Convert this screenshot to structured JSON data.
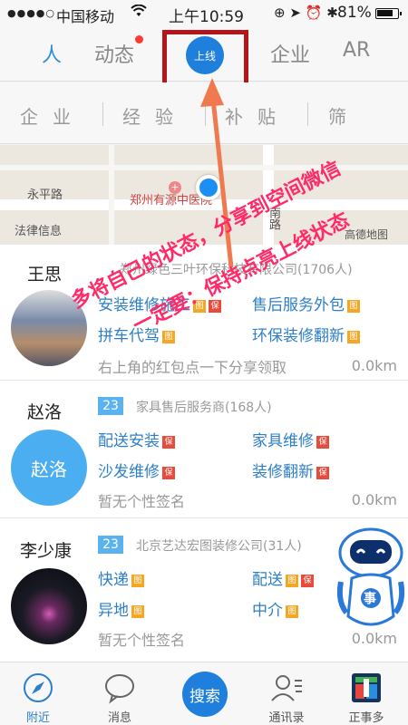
{
  "status_bar": {
    "signal_dots": "●●●●○",
    "carrier": "中国移动",
    "time": "上午10:59",
    "battery_percent": "81%",
    "battery_level": 0.81
  },
  "top_tabs": [
    {
      "label": "人",
      "active": true
    },
    {
      "label": "动态",
      "has_badge": true
    },
    {
      "label": "上线"
    },
    {
      "label": "企业"
    },
    {
      "label": "AR"
    }
  ],
  "filters": [
    "企业",
    "经验",
    "补贴",
    "筛"
  ],
  "map": {
    "labels": [
      "永平路",
      "郑州有源中医院",
      "法律信息",
      "南路"
    ],
    "provider": "高德地图"
  },
  "contacts": [
    {
      "name": "王思",
      "company": "郑州绿色三叶环保科技有限公司(1706人)",
      "services": [
        {
          "label": "安装维修施工",
          "tags": [
            "图",
            "保"
          ]
        },
        {
          "label": "售后服务外包",
          "tags": [
            "图"
          ]
        },
        {
          "label": "拼车代驾",
          "tags": [
            "图"
          ]
        },
        {
          "label": "环保装修翻新",
          "tags": [
            "图"
          ]
        }
      ],
      "signature": "右上角的红包点一下分享领取",
      "distance": "0.0km"
    },
    {
      "name": "赵洛",
      "avatar_text": "赵洛",
      "count": "23",
      "company": "家具售后服务商(168人)",
      "services": [
        {
          "label": "配送安装",
          "tags": [
            "保"
          ]
        },
        {
          "label": "家具维修",
          "tags": [
            "保"
          ]
        },
        {
          "label": "沙发维修",
          "tags": [
            "保"
          ]
        },
        {
          "label": "装修翻新",
          "tags": [
            "保"
          ]
        }
      ],
      "signature": "暂无个性签名",
      "distance": "0.0km"
    },
    {
      "name": "李少康",
      "count": "23",
      "company": "北京艺达宏图装修公司(31人)",
      "services": [
        {
          "label": "快递",
          "tags": [
            "图"
          ]
        },
        {
          "label": "配送",
          "tags": [
            "图",
            "保"
          ]
        },
        {
          "label": "异地",
          "tags": [
            "图"
          ]
        },
        {
          "label": "中介",
          "tags": [
            "图"
          ]
        }
      ],
      "signature": "暂无个性签名",
      "distance": "0.0km"
    }
  ],
  "annotations": {
    "line1": "多将自己的状态，分享到空间微信",
    "line2": "一定要：保持点亮上线状态"
  },
  "robot_label": "事",
  "bottom_nav": [
    {
      "label": "附近",
      "active": true,
      "icon": "compass-icon"
    },
    {
      "label": "消息",
      "icon": "chat-bubble-icon"
    },
    {
      "label": "搜索",
      "icon": "search-button"
    },
    {
      "label": "通讯录",
      "icon": "contacts-icon"
    },
    {
      "label": "正事多",
      "icon": "app-logo-icon"
    }
  ],
  "colors": {
    "accent_blue": "#1e7fdc",
    "annotation_pink": "#ff2a68",
    "highlight_box": "#b3151b",
    "tag_image": "#f5a623",
    "tag_insured": "#e84a3b"
  }
}
